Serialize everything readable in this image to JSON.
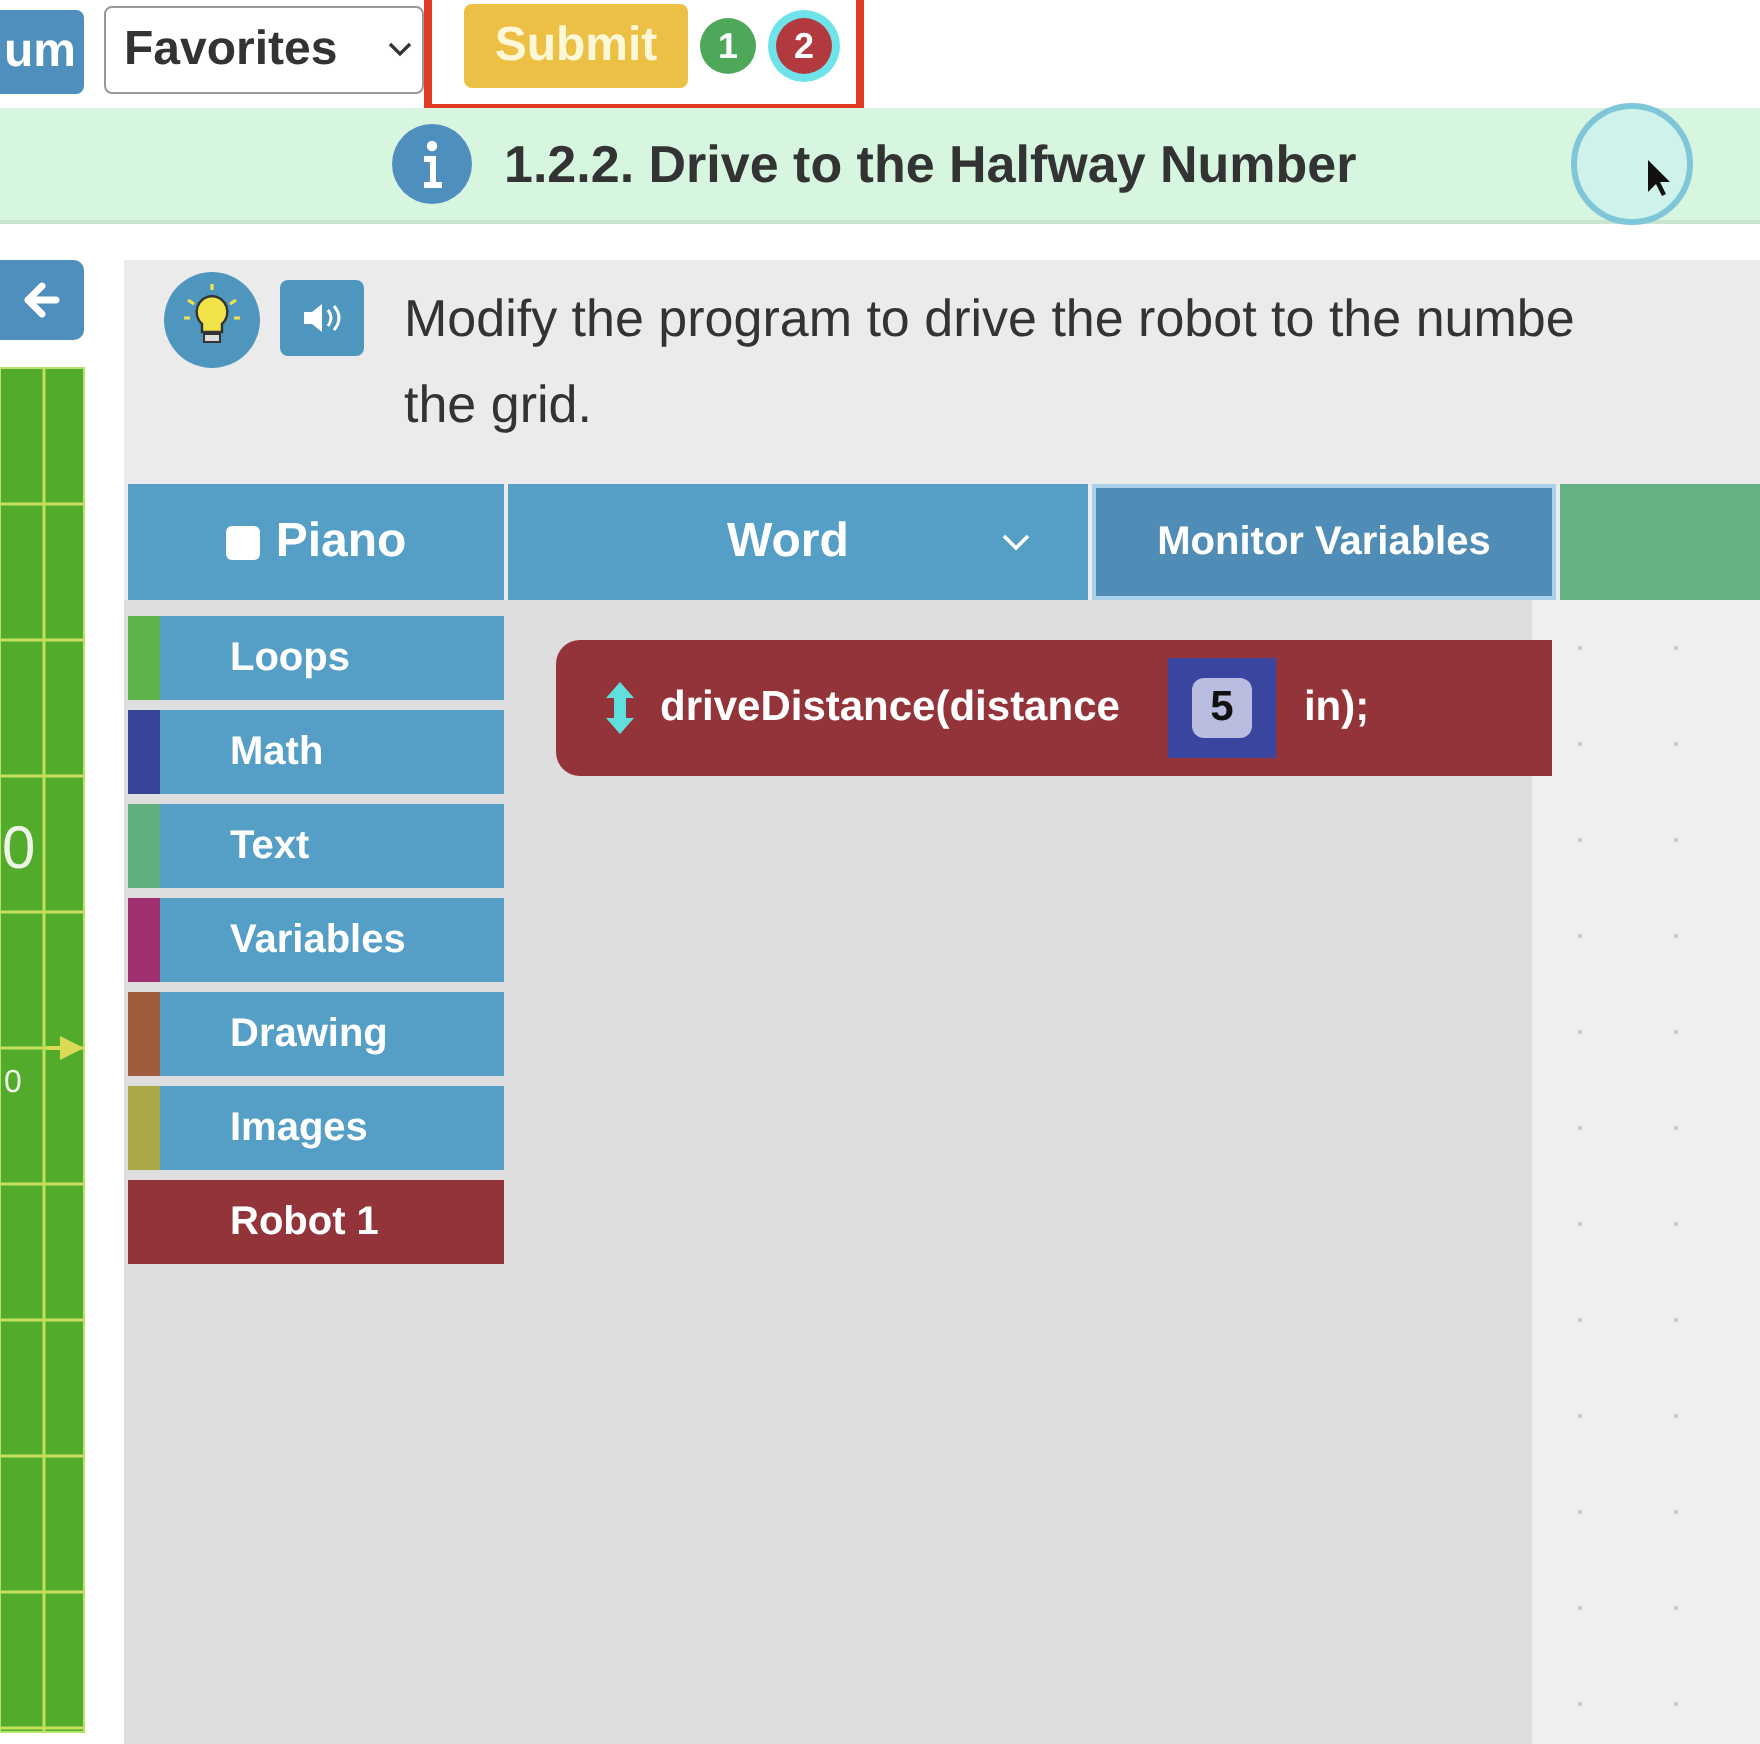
{
  "top_bar": {
    "menu_button": "um",
    "favorites_select": {
      "value": "Favorites"
    },
    "submit_button": "Submit",
    "highlighted": true,
    "badges": [
      {
        "label": "1",
        "color": "#4ea85a",
        "selected": false
      },
      {
        "label": "2",
        "color": "#b23a3f",
        "selected": true
      }
    ]
  },
  "title_bar": {
    "title": "1.2.2. Drive to the Halfway Number"
  },
  "grid": {
    "labels": [
      "0",
      "0"
    ]
  },
  "instruction": {
    "lines": [
      "Modify the program to drive the robot to the numbe",
      "the grid."
    ]
  },
  "tabs": [
    {
      "kind": "checkbox",
      "label": "Piano",
      "checked": false
    },
    {
      "kind": "dropdown",
      "label": "Word"
    },
    {
      "kind": "button",
      "label": "Monitor Variables"
    }
  ],
  "categories": [
    {
      "kind": "category",
      "label": "Loops",
      "color": "#5db44a"
    },
    {
      "kind": "category",
      "label": "Math",
      "color": "#38449a"
    },
    {
      "kind": "category",
      "label": "Text",
      "color": "#5fae7e"
    },
    {
      "kind": "category",
      "label": "Variables",
      "color": "#a0306f"
    },
    {
      "kind": "category",
      "label": "Drawing",
      "color": "#a05a3c"
    },
    {
      "kind": "category",
      "label": "Images",
      "color": "#a9a949"
    },
    {
      "kind": "robot",
      "label": "Robot 1",
      "color": "#93333a"
    }
  ],
  "block": {
    "text": "driveDistance(distance",
    "value": "5",
    "suffix": "in);"
  }
}
